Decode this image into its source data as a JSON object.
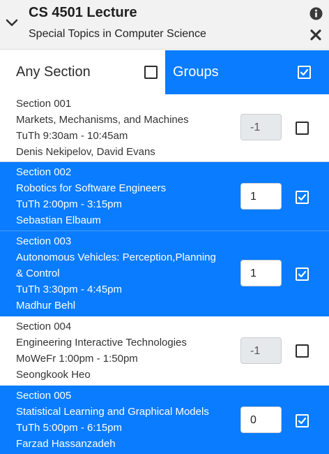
{
  "course": {
    "title": "CS 4501 Lecture",
    "subtitle": "Special Topics in Computer Science"
  },
  "filters": {
    "any_section_label": "Any Section",
    "any_section_checked": false,
    "groups_label": "Groups",
    "groups_checked": true
  },
  "sections": [
    {
      "name": "Section 001",
      "topic": "Markets, Mechanisms, and Machines",
      "time": "TuTh 9:30am - 10:45am",
      "instructors": "Denis Nekipelov, David Evans",
      "value": "-1",
      "checked": false
    },
    {
      "name": "Section 002",
      "topic": "Robotics for Software Engineers",
      "time": "TuTh 2:00pm - 3:15pm",
      "instructors": "Sebastian Elbaum",
      "value": "1",
      "checked": true
    },
    {
      "name": "Section 003",
      "topic_line1": "Autonomous Vehicles: Perception,Planning",
      "topic_line2": "& Control",
      "time": "TuTh 3:30pm - 4:45pm",
      "instructors": "Madhur Behl",
      "value": "1",
      "checked": true
    },
    {
      "name": "Section 004",
      "topic": "Engineering Interactive Technologies",
      "time": "MoWeFr 1:00pm - 1:50pm",
      "instructors": "Seongkook Heo",
      "value": "-1",
      "checked": false
    },
    {
      "name": "Section 005",
      "topic": "Statistical Learning and Graphical Models",
      "time": "TuTh 5:00pm - 6:15pm",
      "instructors": "Farzad Hassanzadeh",
      "value": "0",
      "checked": true
    }
  ],
  "icons": {
    "collapse": "chevron-down-icon",
    "info": "info-icon",
    "close": "close-icon",
    "checked": "checkbox-checked-icon",
    "unchecked": "checkbox-unchecked-icon"
  },
  "colors": {
    "accent": "#0a7cff",
    "header_bg": "#f2f2f2",
    "disabled_input_bg": "#e6e9ec"
  }
}
